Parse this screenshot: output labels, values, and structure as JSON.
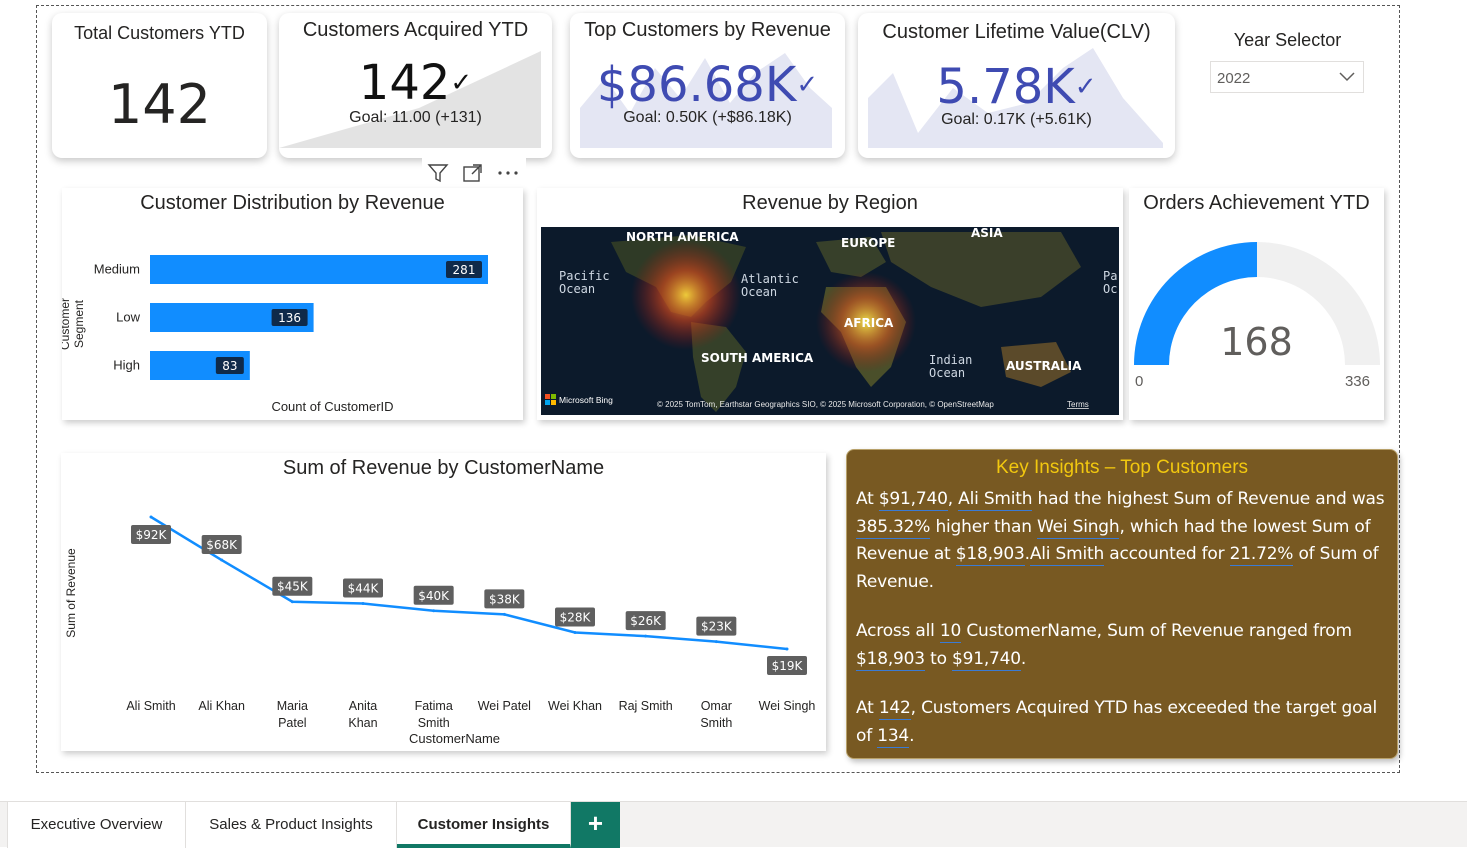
{
  "kpis": {
    "total_customers": {
      "title": "Total Customers YTD",
      "value": "142"
    },
    "acquired": {
      "title": "Customers Acquired YTD",
      "value": "142",
      "goal": "Goal: 11.00 (+131)"
    },
    "top_revenue": {
      "title": "Top Customers by Revenue",
      "value": "$86.68K",
      "goal": "Goal: 0.50K (+$86.18K)"
    },
    "clv": {
      "title": "Customer Lifetime Value(CLV)",
      "value": "5.78K",
      "goal": "Goal: 0.17K (+5.61K)"
    }
  },
  "year_selector": {
    "title": "Year Selector",
    "value": "2022"
  },
  "header_icons": [
    "filter-icon",
    "focus-mode-icon",
    "more-options-icon"
  ],
  "distribution": {
    "title": "Customer Distribution by Revenue",
    "ylabel": "Customer Segment",
    "xlabel": "Count of CustomerID",
    "labels": [
      "281",
      "136",
      "83"
    ]
  },
  "region": {
    "title": "Revenue by Region",
    "labels": {
      "north_america": "NORTH AMERICA",
      "europe": "EUROPE",
      "asia": "ASIA",
      "pacific_left": "Pacific\nOcean",
      "atlantic": "Atlantic\nOcean",
      "pacific_right": "Pa\nOc",
      "africa": "AFRICA",
      "south_america": "SOUTH AMERICA",
      "indian": "Indian\nOcean",
      "australia": "AUSTRALIA"
    },
    "bing": "Microsoft Bing",
    "attribution": "© 2025 TomTom, Earthstar Geographics SIO, © 2025 Microsoft Corporation, © OpenStreetMap",
    "terms": "Terms"
  },
  "gauge": {
    "title": "Orders Achievement YTD",
    "value": "168",
    "min": "0",
    "max": "336"
  },
  "revenue_line": {
    "title": "Sum of Revenue by CustomerName",
    "xlabel": "CustomerName",
    "ylabel": "Sum of Revenue"
  },
  "insights": {
    "title": "Key Insights – Top Customers",
    "p1": [
      {
        "t": "At "
      },
      {
        "t": "$91,740",
        "h": true
      },
      {
        "t": ", "
      },
      {
        "t": "Ali Smith",
        "h": true
      },
      {
        "t": " had the highest Sum of Revenue and was "
      },
      {
        "t": "385.32%",
        "h": true
      },
      {
        "t": " higher than "
      },
      {
        "t": "Wei Singh",
        "h": true
      },
      {
        "t": ", which had the lowest Sum of Revenue at "
      },
      {
        "t": "$18,903",
        "h": true
      },
      {
        "t": "."
      },
      {
        "t": "Ali Smith",
        "h": true
      },
      {
        "t": " accounted for "
      },
      {
        "t": "21.72%",
        "h": true
      },
      {
        "t": " of Sum of Revenue."
      }
    ],
    "p2": [
      {
        "t": "Across all "
      },
      {
        "t": "10",
        "h": true
      },
      {
        "t": " CustomerName, Sum of Revenue ranged from "
      },
      {
        "t": "$18,903",
        "h": true
      },
      {
        "t": " to "
      },
      {
        "t": "$91,740",
        "h": true
      },
      {
        "t": "."
      }
    ],
    "p3": [
      {
        "t": "At "
      },
      {
        "t": "142",
        "h": true
      },
      {
        "t": ", Customers Acquired YTD has exceeded the target goal of "
      },
      {
        "t": "134",
        "h": true
      },
      {
        "t": "."
      }
    ]
  },
  "tabs": [
    {
      "label": "Executive Overview",
      "active": false
    },
    {
      "label": "Sales & Product Insights",
      "active": false
    },
    {
      "label": "Customer Insights",
      "active": true
    }
  ],
  "add_tab": "+",
  "colors": {
    "accent_blue": "#118DFF",
    "kpi_indigo": "#3F4BB2",
    "insights_bg": "#785922",
    "insights_title": "#F2C80F",
    "tab_green": "#117865"
  },
  "chart_data": [
    {
      "type": "bar",
      "title": "Customer Distribution by Revenue",
      "orientation": "horizontal",
      "categories": [
        "Medium",
        "Low",
        "High"
      ],
      "values": [
        281,
        136,
        83
      ],
      "xlabel": "Count of CustomerID",
      "ylabel": "Customer Segment",
      "xlim": [
        0,
        300
      ],
      "legend": "none"
    },
    {
      "type": "line",
      "title": "Sum of Revenue by CustomerName",
      "categories": [
        "Ali Smith",
        "Ali Khan",
        "Maria Patel",
        "Anita Khan",
        "Fatima Smith",
        "Wei Patel",
        "Wei Khan",
        "Raj Smith",
        "Omar Smith",
        "Wei Singh"
      ],
      "values": [
        91740,
        68000,
        45000,
        44000,
        40000,
        38000,
        28000,
        26000,
        23000,
        18903
      ],
      "data_labels": [
        "$92K",
        "$68K",
        "$45K",
        "$44K",
        "$40K",
        "$38K",
        "$28K",
        "$26K",
        "$23K",
        "$19K"
      ],
      "xlabel": "CustomerName",
      "ylabel": "Sum of Revenue",
      "grid": false
    },
    {
      "type": "gauge",
      "title": "Orders Achievement YTD",
      "value": 168,
      "min": 0,
      "max": 336
    }
  ]
}
